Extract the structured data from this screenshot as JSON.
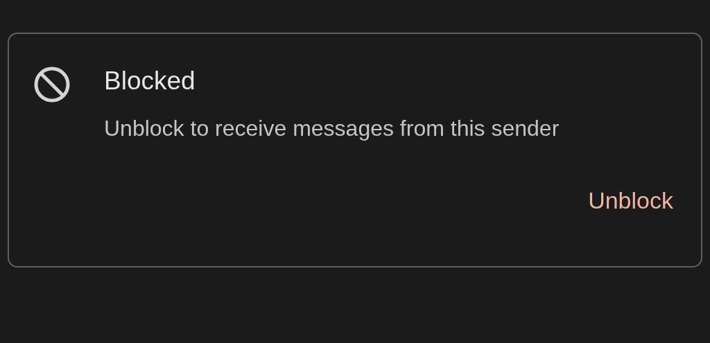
{
  "card": {
    "title": "Blocked",
    "message": "Unblock to receive messages from this sender",
    "action": "Unblock"
  }
}
